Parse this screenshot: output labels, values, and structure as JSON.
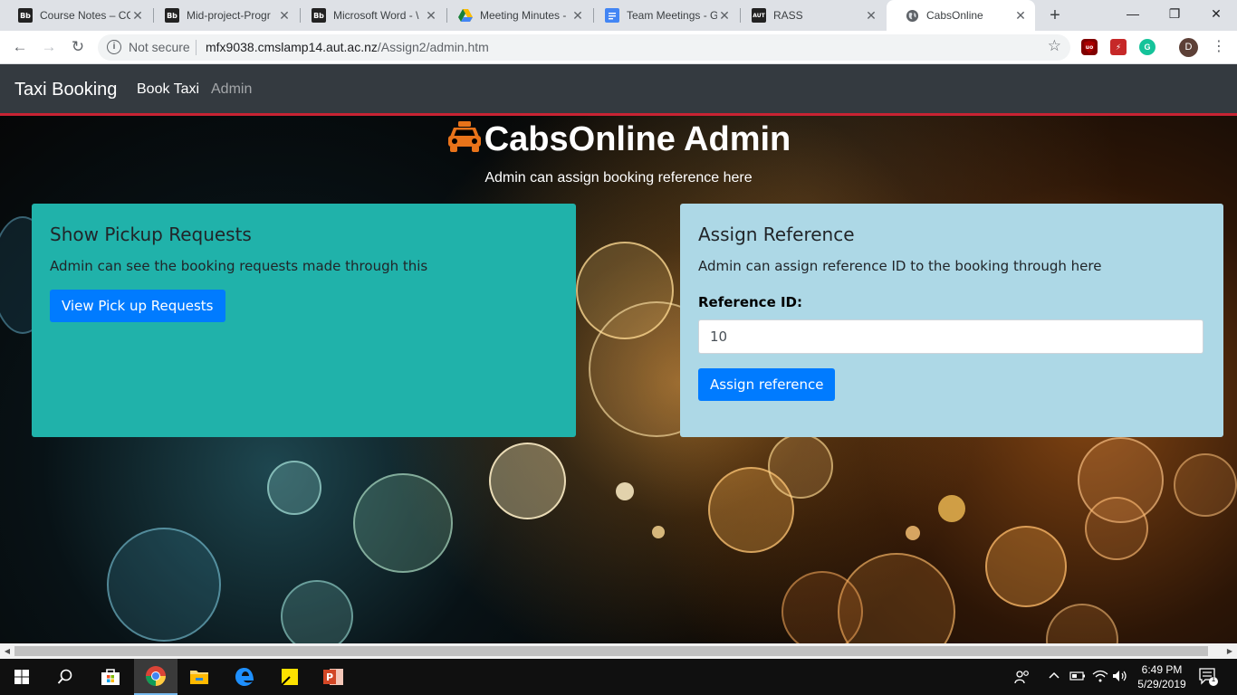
{
  "browser": {
    "tabs": [
      {
        "title": "Course Notes – CC",
        "favicon": "Bb"
      },
      {
        "title": "Mid-project-Progr",
        "favicon": "Bb"
      },
      {
        "title": "Microsoft Word - \\",
        "favicon": "Bb"
      },
      {
        "title": "Meeting Minutes -",
        "favicon": "drive-icon"
      },
      {
        "title": "Team Meetings - G",
        "favicon": "docs-icon"
      },
      {
        "title": "RASS",
        "favicon": "AUT"
      },
      {
        "title": "CabsOnline",
        "favicon": "globe-icon"
      }
    ],
    "not_secure": "Not secure",
    "url_host": "mfx9038.cmslamp14.aut.ac.nz",
    "url_path": "/Assign2/admin.htm",
    "profile_initial": "D"
  },
  "navbar": {
    "brand": "Taxi Booking",
    "links": [
      "Book Taxi",
      "Admin"
    ]
  },
  "hero": {
    "title": "CabsOnline Admin",
    "subtitle": "Admin can assign booking reference here"
  },
  "left_card": {
    "heading": "Show Pickup Requests",
    "text": "Admin can see the booking requests made through this",
    "button": "View Pick up Requests",
    "color": "#20b2aa"
  },
  "right_card": {
    "heading": "Assign Reference",
    "text": "Admin can assign reference ID to the booking through here",
    "label": "Reference ID:",
    "input_value": "10",
    "button": "Assign reference",
    "color": "#add8e6"
  },
  "taskbar": {
    "time": "6:49 PM",
    "date": "5/29/2019",
    "notifications": "1"
  }
}
